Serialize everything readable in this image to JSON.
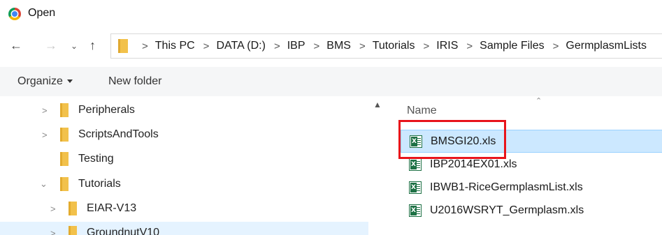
{
  "window": {
    "title": "Open",
    "icon": "chrome-icon"
  },
  "address": {
    "crumbs": [
      "This PC",
      "DATA (D:)",
      "IBP",
      "BMS",
      "Tutorials",
      "IRIS",
      "Sample Files",
      "GermplasmLists"
    ]
  },
  "toolbar": {
    "organize_label": "Organize",
    "new_folder_label": "New folder"
  },
  "nav_tree": [
    {
      "label": "Peripherals",
      "expandable": true
    },
    {
      "label": "ScriptsAndTools",
      "expandable": true
    },
    {
      "label": "Testing",
      "expandable": false
    },
    {
      "label": "Tutorials",
      "expandable": true,
      "expanded": true
    },
    {
      "label": "EIAR-V13",
      "expandable": true
    },
    {
      "label": "GroundnutV10",
      "expandable": true
    }
  ],
  "filelist": {
    "column_name": "Name",
    "files": [
      {
        "name": "BMSGI20.xls",
        "selected": true
      },
      {
        "name": "IBP2014EX01.xls",
        "selected": false
      },
      {
        "name": "IBWB1-RiceGermplasmList.xls",
        "selected": false
      },
      {
        "name": "U2016WSRYT_Germplasm.xls",
        "selected": false
      }
    ]
  },
  "colors": {
    "selection_bg": "#cce8ff",
    "hover_bg": "#e5f3ff",
    "annotation_border": "#e8141b",
    "folder": "#f2c14b",
    "excel_green": "#1e7145"
  }
}
